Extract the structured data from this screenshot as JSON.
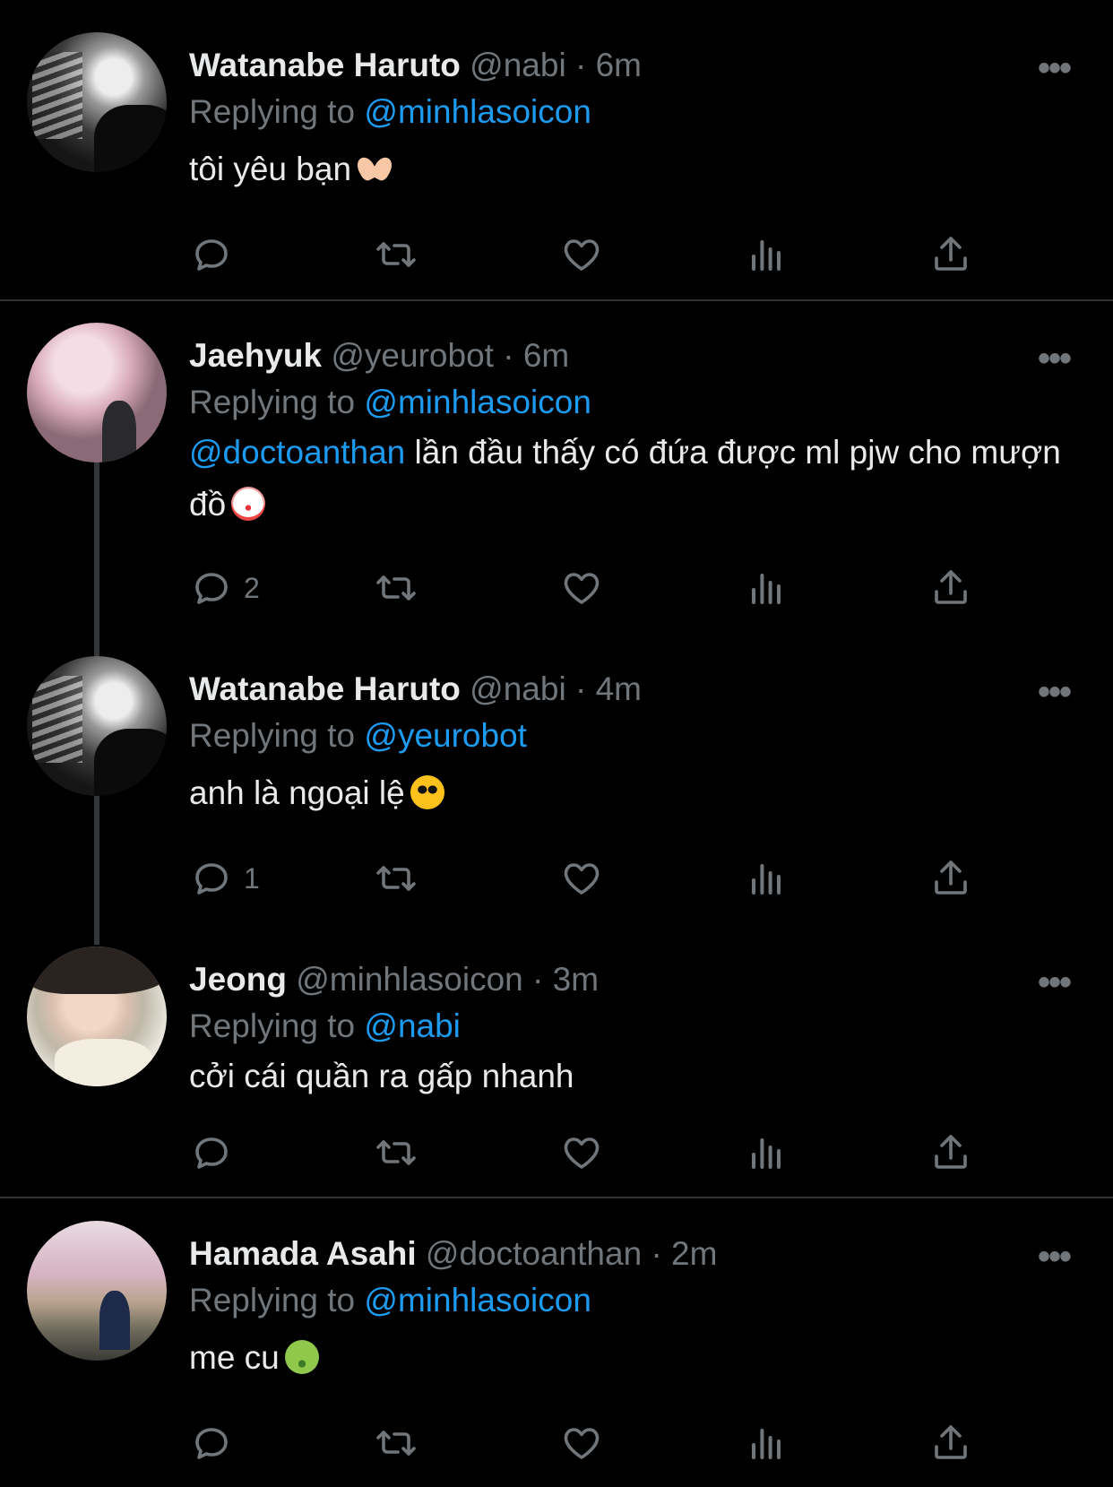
{
  "tweets": [
    {
      "name": "Watanabe Haruto",
      "handle": "@nabi",
      "separator": "·",
      "time": "6m",
      "replying_label": "Replying to",
      "replying_to": "@minhlasoicon",
      "text_mention": "",
      "text": "tôi yêu bạn",
      "emoji": "heart-hands-emoji",
      "reply_count": "",
      "more_label": "•••"
    },
    {
      "name": "Jaehyuk",
      "handle": "@yeurobot",
      "separator": "·",
      "time": "6m",
      "replying_label": "Replying to",
      "replying_to": "@minhlasoicon",
      "text_mention": "@doctoanthan",
      "text": " lần đầu thấy có đứa được ml pjw cho mượn đồ",
      "emoji": "clown-face-emoji",
      "reply_count": "2",
      "more_label": "•••"
    },
    {
      "name": "Watanabe Haruto",
      "handle": "@nabi",
      "separator": "·",
      "time": "4m",
      "replying_label": "Replying to",
      "replying_to": "@yeurobot",
      "text_mention": "",
      "text": "anh là ngoại lệ",
      "emoji": "sunglasses-face-emoji",
      "reply_count": "1",
      "more_label": "•••"
    },
    {
      "name": "Jeong",
      "handle": "@minhlasoicon",
      "separator": "·",
      "time": "3m",
      "replying_label": "Replying to",
      "replying_to": "@nabi",
      "text_mention": "",
      "text": "cởi cái quần ra gấp nhanh",
      "emoji": "",
      "reply_count": "",
      "more_label": "•••"
    },
    {
      "name": "Hamada Asahi",
      "handle": "@doctoanthan",
      "separator": "·",
      "time": "2m",
      "replying_label": "Replying to",
      "replying_to": "@minhlasoicon",
      "text_mention": "",
      "text": "me cu",
      "emoji": "nauseated-face-emoji",
      "reply_count": "",
      "more_label": "•••"
    }
  ],
  "colors": {
    "background": "#000000",
    "text": "#e7e9ea",
    "secondary": "#71767b",
    "link": "#1d9bf0",
    "divider": "#2f3336"
  },
  "icons": [
    "reply-icon",
    "retweet-icon",
    "like-icon",
    "views-icon",
    "share-icon",
    "more-icon"
  ]
}
